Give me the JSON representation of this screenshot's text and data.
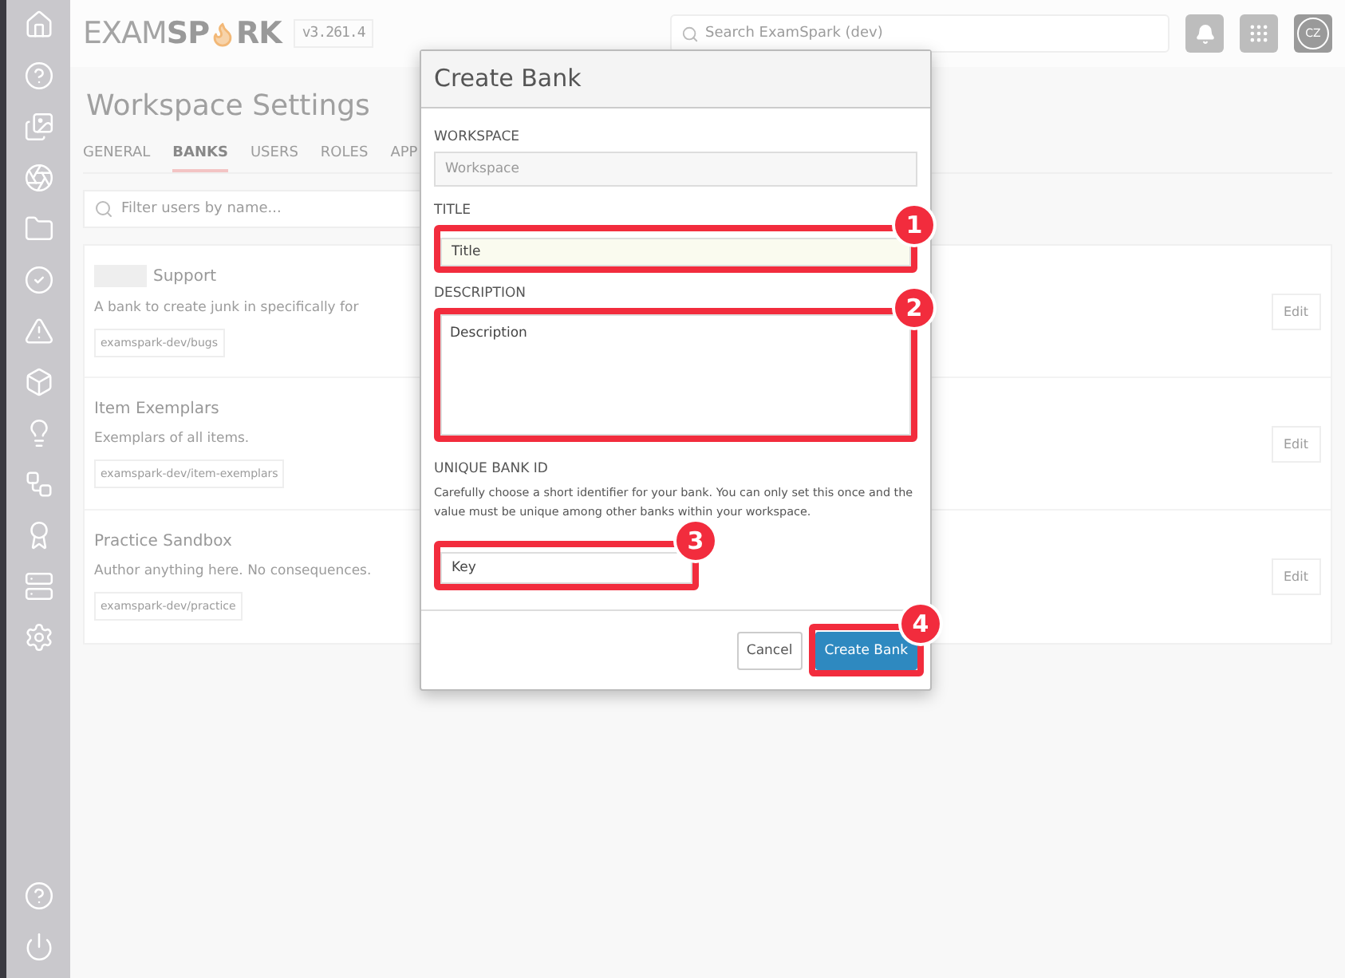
{
  "header": {
    "logo": {
      "left": "EXAM",
      "middle": "SP",
      "right": "RK"
    },
    "version": "v3.261.4",
    "search": {
      "placeholder": "Search ExamSpark (dev)"
    },
    "avatar": "CZ"
  },
  "page": {
    "title": "Workspace Settings",
    "tabs": [
      {
        "label": "GENERAL",
        "selected": false
      },
      {
        "label": "BANKS",
        "selected": true
      },
      {
        "label": "USERS",
        "selected": false
      },
      {
        "label": "ROLES",
        "selected": false
      },
      {
        "label": "APP",
        "selected": false
      }
    ],
    "filter": {
      "placeholder": "Filter users by name..."
    },
    "banks": [
      {
        "name": "Support",
        "redacted": true,
        "description": "A bank to create junk in specifically for",
        "key": "examspark-dev/bugs",
        "action": "Edit"
      },
      {
        "name": "Item Exemplars",
        "redacted": false,
        "description": "Exemplars of all items.",
        "key": "examspark-dev/item-exemplars",
        "action": "Edit"
      },
      {
        "name": "Practice Sandbox",
        "redacted": false,
        "description": "Author anything here. No consequences.",
        "key": "examspark-dev/practice",
        "action": "Edit"
      }
    ]
  },
  "dialog": {
    "title": "Create Bank",
    "workspace": {
      "label": "WORKSPACE",
      "placeholder": "Workspace"
    },
    "title_field": {
      "label": "TITLE",
      "value": "Title",
      "callout": "1"
    },
    "description": {
      "label": "DESCRIPTION",
      "placeholder": "Description",
      "callout": "2"
    },
    "unique_id": {
      "label": "UNIQUE BANK ID",
      "help": "Carefully choose a short identifier for your bank. You can only set this once and the value must be unique among other banks within your workspace.",
      "placeholder": "Key",
      "callout": "3"
    },
    "buttons": [
      {
        "label": "Cancel",
        "kind": "secondary"
      },
      {
        "label": "Create Bank",
        "kind": "primary",
        "callout": "4"
      }
    ]
  }
}
